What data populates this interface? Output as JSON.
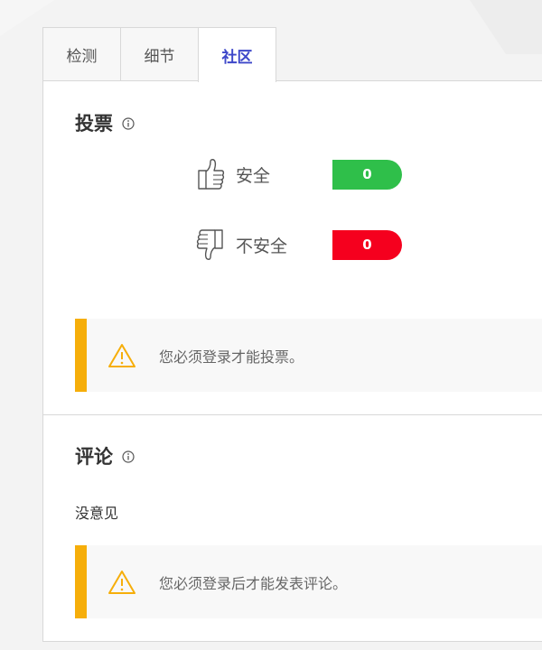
{
  "tabs": [
    {
      "label": "检测",
      "active": false
    },
    {
      "label": "细节",
      "active": false
    },
    {
      "label": "社区",
      "active": true
    }
  ],
  "votes": {
    "title": "投票",
    "info_icon": "info-icon",
    "safe": {
      "label": "安全",
      "count": "0",
      "icon": "thumbs-up-icon",
      "color": "#2fbf4a"
    },
    "unsafe": {
      "label": "不安全",
      "count": "0",
      "icon": "thumbs-down-icon",
      "color": "#f5001e"
    },
    "login_notice": "您必须登录才能投票。"
  },
  "comments": {
    "title": "评论",
    "info_icon": "info-icon",
    "empty_text": "没意见",
    "login_notice": "您必须登录后才能发表评论。"
  },
  "colors": {
    "accent": "#3d47c9",
    "warning": "#f6ae0a"
  }
}
